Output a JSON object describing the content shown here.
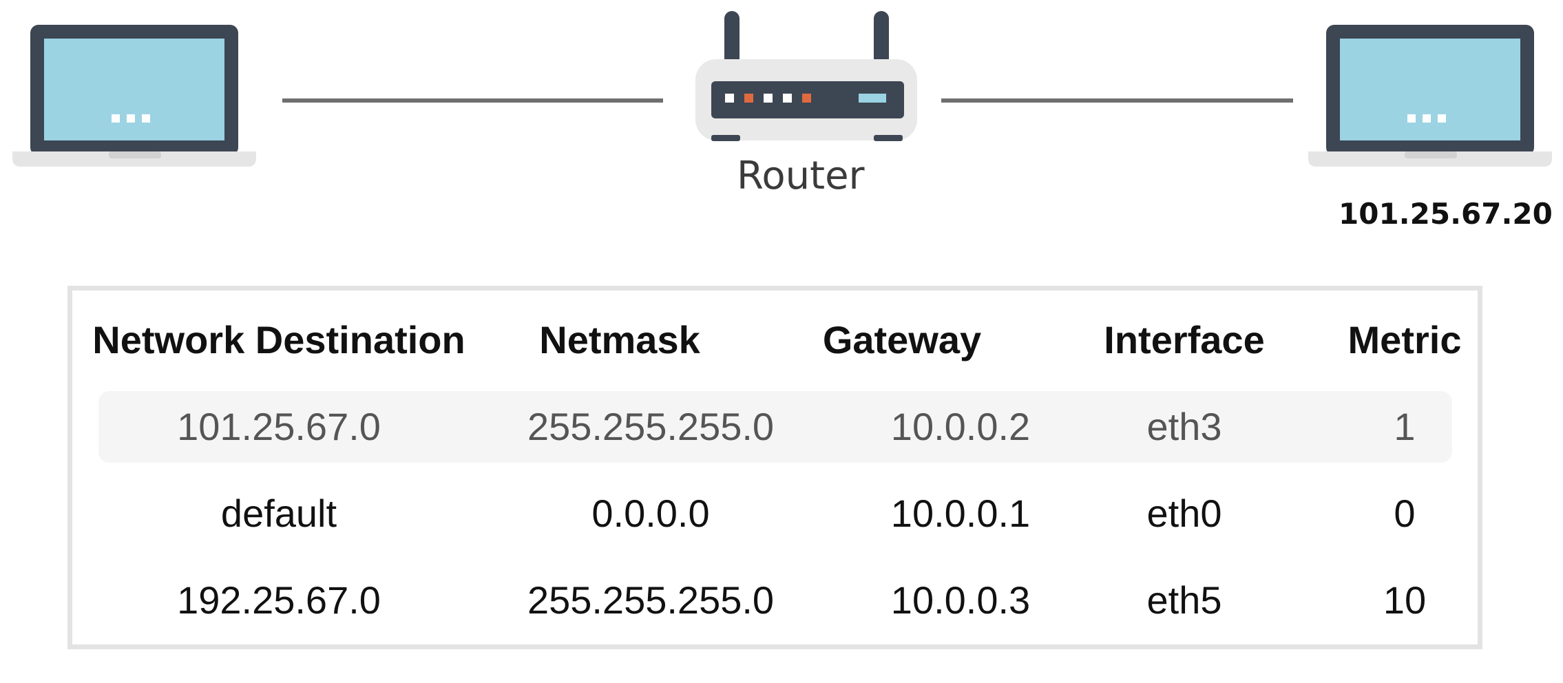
{
  "diagram": {
    "router_label": "Router",
    "destination_ip": "101.25.67.20",
    "colors": {
      "screen": "#9bd3e3",
      "frame": "#3d4653",
      "link": "#6f6f6f",
      "router_body": "#e9e9e9",
      "router_panel": "#3d4653",
      "led_white": "#ffffff",
      "led_orange": "#e06a3f",
      "led_blue": "#9bd3e3"
    },
    "icons": [
      "laptop-icon",
      "router-icon",
      "laptop-icon"
    ]
  },
  "routing_table": {
    "headers": {
      "destination": "Network Destination",
      "netmask": "Netmask",
      "gateway": "Gateway",
      "interface": "Interface",
      "metric": "Metric"
    },
    "rows": [
      {
        "destination": "101.25.67.0",
        "netmask": "255.255.255.0",
        "gateway": "10.0.0.2",
        "interface": "eth3",
        "metric": "1"
      },
      {
        "destination": "default",
        "netmask": "0.0.0.0",
        "gateway": "10.0.0.1",
        "interface": "eth0",
        "metric": "0"
      },
      {
        "destination": "192.25.67.0",
        "netmask": "255.255.255.0",
        "gateway": "10.0.0.3",
        "interface": "eth5",
        "metric": "10"
      }
    ]
  }
}
